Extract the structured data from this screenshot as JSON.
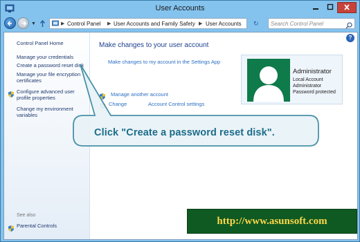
{
  "window": {
    "title": "User Accounts"
  },
  "nav": {
    "breadcrumbs": [
      "Control Panel",
      "User Accounts and Family Safety",
      "User Accounts"
    ],
    "search_placeholder": "Search Control Panel"
  },
  "sidebar": {
    "home": "Control Panel Home",
    "items": [
      {
        "label": "Manage your credentials",
        "shield": false
      },
      {
        "label": "Create a password reset disk",
        "shield": false
      },
      {
        "label_lines": [
          "Manage your file encryption",
          "certificates"
        ],
        "shield": false
      },
      {
        "label_lines": [
          "Configure advanced user",
          "profile properties"
        ],
        "shield": true
      },
      {
        "label_lines": [
          "Change my environment",
          "variables"
        ],
        "shield": false
      }
    ],
    "see_also": "See also",
    "parental_controls": "Parental Controls"
  },
  "main": {
    "title": "Make changes to your user account",
    "settings_link": "Make changes to my account in the Settings App",
    "manage_link_visible": "Manage another account",
    "uac_link_left": "Change",
    "uac_link_right": "Account Control settings"
  },
  "account": {
    "name": "Administrator",
    "type": "Local Account",
    "role": "Administrator",
    "status": "Password protected"
  },
  "callout": {
    "text": "Click \"Create a password reset disk\"."
  },
  "watermark": {
    "url": "http://www.asunsoft.com"
  },
  "colors": {
    "link": "#2b6ec4",
    "title": "#1e3f8c",
    "avatar": "#0f7a4a",
    "callout_fill": "#e9f3f7",
    "callout_stroke": "#3e8aa3",
    "banner_bg": "#0f5a22",
    "banner_text": "#ffd74a"
  }
}
